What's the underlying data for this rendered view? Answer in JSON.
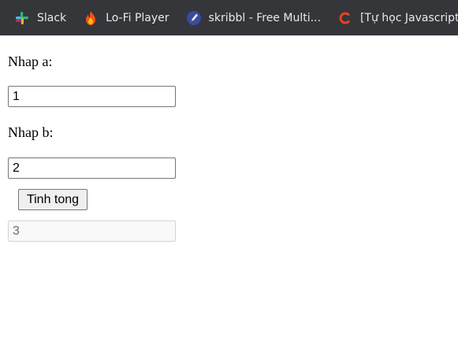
{
  "bookmarks": [
    {
      "label": "Slack",
      "icon": "slack-icon"
    },
    {
      "label": "Lo-Fi Player",
      "icon": "flame-icon"
    },
    {
      "label": "skribbl - Free Multi...",
      "icon": "skribbl-pencil-icon"
    },
    {
      "label": "[Tự học Javascript]...",
      "icon": "c-logo-icon"
    }
  ],
  "form": {
    "label_a": "Nhap a:",
    "value_a": "1",
    "label_b": "Nhap b:",
    "value_b": "2",
    "button_label": "Tinh tong",
    "result_value": "3"
  },
  "colors": {
    "bookmarks_bar_bg": "#35363a",
    "bookmarks_text": "#e8eaed",
    "lofi_flame": "#f4511e",
    "c_logo": "#e8411f"
  }
}
